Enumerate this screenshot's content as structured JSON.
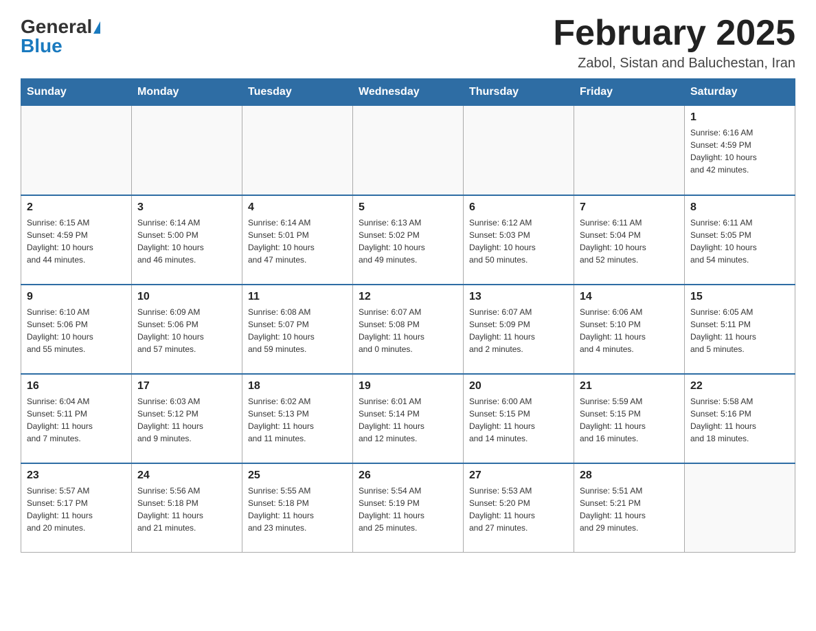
{
  "header": {
    "logo_general": "General",
    "logo_blue": "Blue",
    "title": "February 2025",
    "subtitle": "Zabol, Sistan and Baluchestan, Iran"
  },
  "days_of_week": [
    "Sunday",
    "Monday",
    "Tuesday",
    "Wednesday",
    "Thursday",
    "Friday",
    "Saturday"
  ],
  "weeks": [
    [
      {
        "day": "",
        "info": ""
      },
      {
        "day": "",
        "info": ""
      },
      {
        "day": "",
        "info": ""
      },
      {
        "day": "",
        "info": ""
      },
      {
        "day": "",
        "info": ""
      },
      {
        "day": "",
        "info": ""
      },
      {
        "day": "1",
        "info": "Sunrise: 6:16 AM\nSunset: 4:59 PM\nDaylight: 10 hours\nand 42 minutes."
      }
    ],
    [
      {
        "day": "2",
        "info": "Sunrise: 6:15 AM\nSunset: 4:59 PM\nDaylight: 10 hours\nand 44 minutes."
      },
      {
        "day": "3",
        "info": "Sunrise: 6:14 AM\nSunset: 5:00 PM\nDaylight: 10 hours\nand 46 minutes."
      },
      {
        "day": "4",
        "info": "Sunrise: 6:14 AM\nSunset: 5:01 PM\nDaylight: 10 hours\nand 47 minutes."
      },
      {
        "day": "5",
        "info": "Sunrise: 6:13 AM\nSunset: 5:02 PM\nDaylight: 10 hours\nand 49 minutes."
      },
      {
        "day": "6",
        "info": "Sunrise: 6:12 AM\nSunset: 5:03 PM\nDaylight: 10 hours\nand 50 minutes."
      },
      {
        "day": "7",
        "info": "Sunrise: 6:11 AM\nSunset: 5:04 PM\nDaylight: 10 hours\nand 52 minutes."
      },
      {
        "day": "8",
        "info": "Sunrise: 6:11 AM\nSunset: 5:05 PM\nDaylight: 10 hours\nand 54 minutes."
      }
    ],
    [
      {
        "day": "9",
        "info": "Sunrise: 6:10 AM\nSunset: 5:06 PM\nDaylight: 10 hours\nand 55 minutes."
      },
      {
        "day": "10",
        "info": "Sunrise: 6:09 AM\nSunset: 5:06 PM\nDaylight: 10 hours\nand 57 minutes."
      },
      {
        "day": "11",
        "info": "Sunrise: 6:08 AM\nSunset: 5:07 PM\nDaylight: 10 hours\nand 59 minutes."
      },
      {
        "day": "12",
        "info": "Sunrise: 6:07 AM\nSunset: 5:08 PM\nDaylight: 11 hours\nand 0 minutes."
      },
      {
        "day": "13",
        "info": "Sunrise: 6:07 AM\nSunset: 5:09 PM\nDaylight: 11 hours\nand 2 minutes."
      },
      {
        "day": "14",
        "info": "Sunrise: 6:06 AM\nSunset: 5:10 PM\nDaylight: 11 hours\nand 4 minutes."
      },
      {
        "day": "15",
        "info": "Sunrise: 6:05 AM\nSunset: 5:11 PM\nDaylight: 11 hours\nand 5 minutes."
      }
    ],
    [
      {
        "day": "16",
        "info": "Sunrise: 6:04 AM\nSunset: 5:11 PM\nDaylight: 11 hours\nand 7 minutes."
      },
      {
        "day": "17",
        "info": "Sunrise: 6:03 AM\nSunset: 5:12 PM\nDaylight: 11 hours\nand 9 minutes."
      },
      {
        "day": "18",
        "info": "Sunrise: 6:02 AM\nSunset: 5:13 PM\nDaylight: 11 hours\nand 11 minutes."
      },
      {
        "day": "19",
        "info": "Sunrise: 6:01 AM\nSunset: 5:14 PM\nDaylight: 11 hours\nand 12 minutes."
      },
      {
        "day": "20",
        "info": "Sunrise: 6:00 AM\nSunset: 5:15 PM\nDaylight: 11 hours\nand 14 minutes."
      },
      {
        "day": "21",
        "info": "Sunrise: 5:59 AM\nSunset: 5:15 PM\nDaylight: 11 hours\nand 16 minutes."
      },
      {
        "day": "22",
        "info": "Sunrise: 5:58 AM\nSunset: 5:16 PM\nDaylight: 11 hours\nand 18 minutes."
      }
    ],
    [
      {
        "day": "23",
        "info": "Sunrise: 5:57 AM\nSunset: 5:17 PM\nDaylight: 11 hours\nand 20 minutes."
      },
      {
        "day": "24",
        "info": "Sunrise: 5:56 AM\nSunset: 5:18 PM\nDaylight: 11 hours\nand 21 minutes."
      },
      {
        "day": "25",
        "info": "Sunrise: 5:55 AM\nSunset: 5:18 PM\nDaylight: 11 hours\nand 23 minutes."
      },
      {
        "day": "26",
        "info": "Sunrise: 5:54 AM\nSunset: 5:19 PM\nDaylight: 11 hours\nand 25 minutes."
      },
      {
        "day": "27",
        "info": "Sunrise: 5:53 AM\nSunset: 5:20 PM\nDaylight: 11 hours\nand 27 minutes."
      },
      {
        "day": "28",
        "info": "Sunrise: 5:51 AM\nSunset: 5:21 PM\nDaylight: 11 hours\nand 29 minutes."
      },
      {
        "day": "",
        "info": ""
      }
    ]
  ]
}
